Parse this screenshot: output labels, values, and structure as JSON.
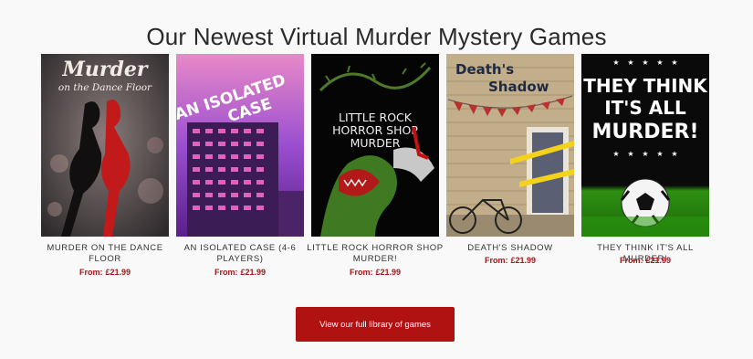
{
  "section": {
    "title": "Our Newest Virtual Murder Mystery Games"
  },
  "price_prefix": "From:",
  "games": [
    {
      "cover_title_line1": "Murder",
      "cover_title_line2": "on the Dance Floor",
      "name": "MURDER ON THE DANCE FLOOR",
      "price": "£21.99"
    },
    {
      "cover_title_line1": "AN ISOLATED",
      "cover_title_line2": "CASE",
      "name": "AN ISOLATED CASE (4-6 PLAYERS)",
      "price": "£21.99"
    },
    {
      "cover_title_line1": "LITTLE ROCK",
      "cover_title_line2": "HORROR SHOP",
      "cover_title_line3": "MURDER",
      "name": "LITTLE ROCK HORROR SHOP MURDER!",
      "price": "£21.99"
    },
    {
      "cover_title_line1": "Death's",
      "cover_title_line2": "Shadow",
      "name": "DEATH'S SHADOW",
      "price": "£21.99"
    },
    {
      "cover_title_line1": "THEY THINK",
      "cover_title_line2": "IT'S ALL",
      "cover_title_line3": "MURDER!",
      "name": "THEY THINK IT'S ALL MURDER!",
      "price": "£21.99"
    }
  ],
  "cta": {
    "label": "View our full library of games"
  },
  "colors": {
    "accent": "#b01212",
    "price": "#a01818"
  }
}
